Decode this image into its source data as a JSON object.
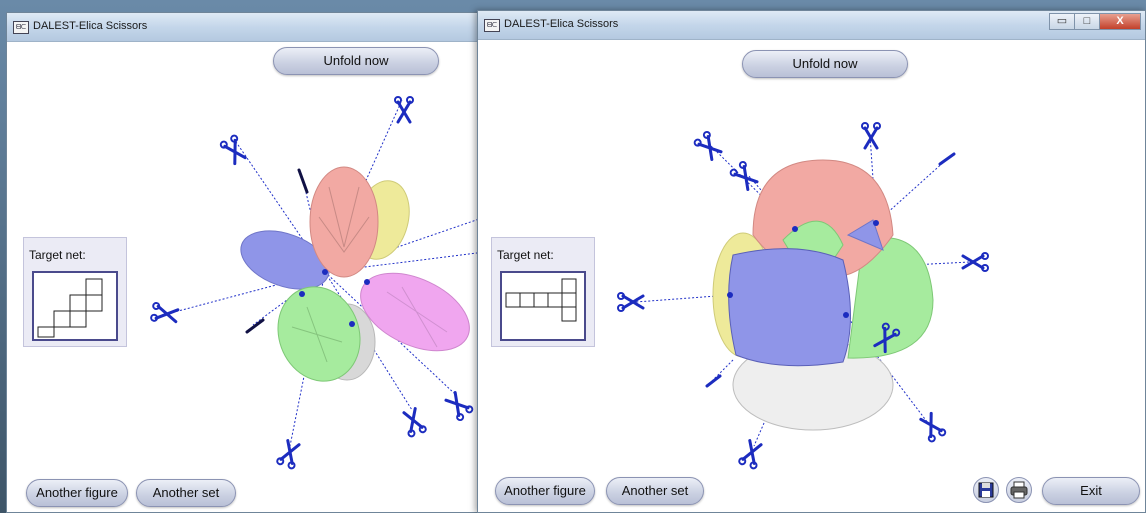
{
  "left_window": {
    "title": "DALEST-Elica Scissors",
    "unfold_label": "Unfold now",
    "target_net_label": "Target net:",
    "another_figure_label": "Another figure",
    "another_set_label": "Another set"
  },
  "right_window": {
    "title": "DALEST-Elica Scissors",
    "unfold_label": "Unfold now",
    "target_net_label": "Target net:",
    "another_figure_label": "Another figure",
    "another_set_label": "Another set",
    "exit_label": "Exit",
    "controls": {
      "minimize": "▭",
      "maximize": "□",
      "close": "X"
    }
  },
  "app_icon_text": "ᗺᑕ",
  "colors": {
    "face_blue": "#8f95e8",
    "face_pink": "#f2a9a3",
    "face_green": "#a6eb9e",
    "face_magenta": "#f0a6ef",
    "face_yellow": "#eeea9a",
    "face_gray": "#d8d8d8",
    "scissors": "#1c2cbf",
    "button_border": "#8b93b3"
  },
  "icons": [
    "scissors-icon",
    "save-icon",
    "print-icon"
  ]
}
